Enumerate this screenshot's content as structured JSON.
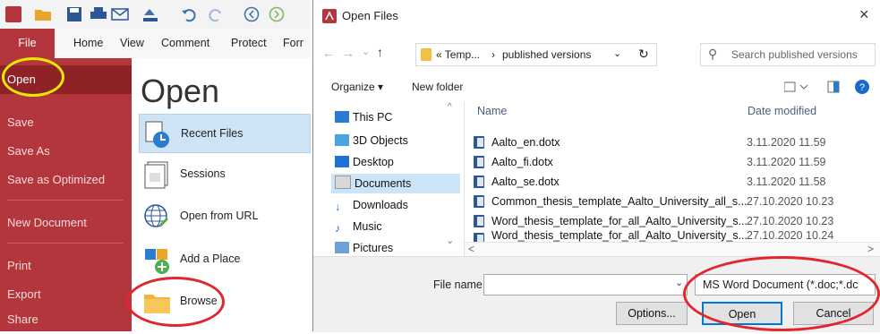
{
  "app": {
    "ribbon_tabs": [
      "File",
      "Home",
      "View",
      "Comment",
      "Protect",
      "Forr"
    ],
    "backstage": {
      "items": [
        {
          "label": "Open"
        },
        {
          "label": "Save"
        },
        {
          "label": "Save As"
        },
        {
          "label": "Save as Optimized"
        },
        {
          "label": "New Document"
        },
        {
          "label": "Print"
        },
        {
          "label": "Export"
        },
        {
          "label": "Share"
        }
      ]
    },
    "open_pane": {
      "heading": "Open",
      "items": [
        {
          "label": "Recent Files",
          "icon": "recent-files-icon"
        },
        {
          "label": "Sessions",
          "icon": "sessions-icon"
        },
        {
          "label": "Open from URL",
          "icon": "globe-link-icon"
        },
        {
          "label": "Add a Place",
          "icon": "add-place-icon"
        },
        {
          "label": "Browse",
          "icon": "folder-icon"
        }
      ]
    }
  },
  "dialog": {
    "title": "Open Files",
    "close_glyph": "×",
    "path": {
      "root": "« Temp...",
      "sep": "›",
      "current": "published versions"
    },
    "search_placeholder": "Search published versions",
    "toolbar": {
      "organize": "Organize ▾",
      "new_folder": "New folder"
    },
    "nav": [
      {
        "label": "This PC"
      },
      {
        "label": "3D Objects"
      },
      {
        "label": "Desktop"
      },
      {
        "label": "Documents"
      },
      {
        "label": "Downloads"
      },
      {
        "label": "Music"
      },
      {
        "label": "Pictures"
      }
    ],
    "columns": {
      "name": "Name",
      "date": "Date modified"
    },
    "files": [
      {
        "name": "Aalto_en.dotx",
        "date": "3.11.2020 11.59"
      },
      {
        "name": "Aalto_fi.dotx",
        "date": "3.11.2020 11.59"
      },
      {
        "name": "Aalto_se.dotx",
        "date": "3.11.2020 11.58"
      },
      {
        "name": "Common_thesis_template_Aalto_University_all_s...",
        "date": "27.10.2020 10.23"
      },
      {
        "name": "Word_thesis_template_for_all_Aalto_University_s...",
        "date": "27.10.2020 10.23"
      },
      {
        "name": "Word_thesis_template_for_all_Aalto_University_s...",
        "date": "27.10.2020 10.24"
      }
    ],
    "file_name_label": "File name:",
    "file_name_value": "",
    "file_type": "MS Word Document (*.doc;*.dc",
    "buttons": {
      "options": "Options...",
      "open": "Open",
      "cancel": "Cancel"
    }
  },
  "colors": {
    "accent": "#b2363b",
    "dark_accent": "#8e2227",
    "highlight_circle": "#e8e800",
    "annotation_red": "#e3262e",
    "selection": "#cce4f7"
  }
}
